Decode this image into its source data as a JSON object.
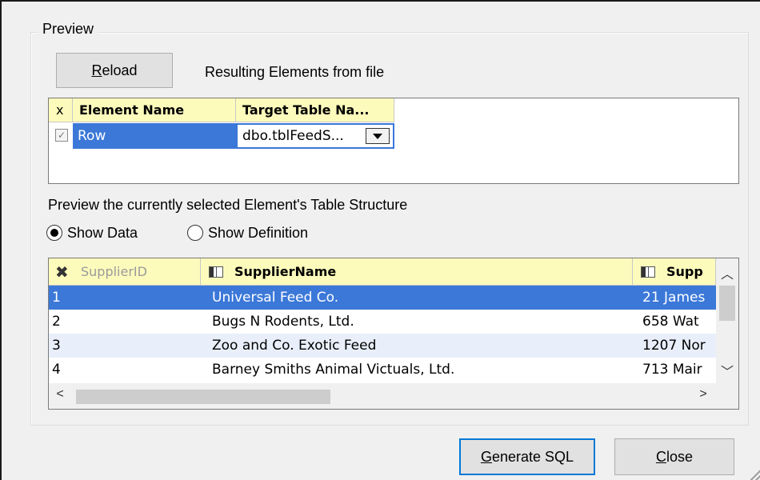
{
  "preview": {
    "group_title": "Preview",
    "reload_button": {
      "accel": "R",
      "rest": "eload"
    },
    "resulting_label": "Resulting Elements from file",
    "elements_grid": {
      "headers": {
        "x": "x",
        "element_name": "Element Name",
        "target_table": "Target Table Na..."
      },
      "rows": [
        {
          "checked": true,
          "element_name": "Row",
          "target_table": "dbo.tblFeedS..."
        }
      ]
    },
    "structure_label": "Preview the currently selected Element's Table Structure",
    "radio": {
      "show_data": "Show Data",
      "show_definition": "Show Definition",
      "selected": "show_data"
    },
    "data_grid": {
      "headers": {
        "supplier_id": "SupplierID",
        "supplier_name": "SupplierName",
        "supplier_addr": "Supp"
      },
      "rows": [
        {
          "id": "1",
          "name": "Universal Feed Co.",
          "addr": "21 James"
        },
        {
          "id": "2",
          "name": "Bugs N Rodents, Ltd.",
          "addr": "658 Wat"
        },
        {
          "id": "3",
          "name": "Zoo and Co. Exotic Feed",
          "addr": "1207 Nor"
        },
        {
          "id": "4",
          "name": "Barney Smiths Animal Victuals, Ltd.",
          "addr": "713 Mair"
        }
      ],
      "selected_row": 0
    }
  },
  "buttons": {
    "generate_sql": {
      "accel": "G",
      "rest": "enerate SQL"
    },
    "close": {
      "accel": "C",
      "rest": "lose"
    }
  },
  "colors": {
    "header_bg": "#fdfbbc",
    "selection": "#3b78d8",
    "alt_row": "#e8effa",
    "default_button_border": "#0078d7"
  }
}
